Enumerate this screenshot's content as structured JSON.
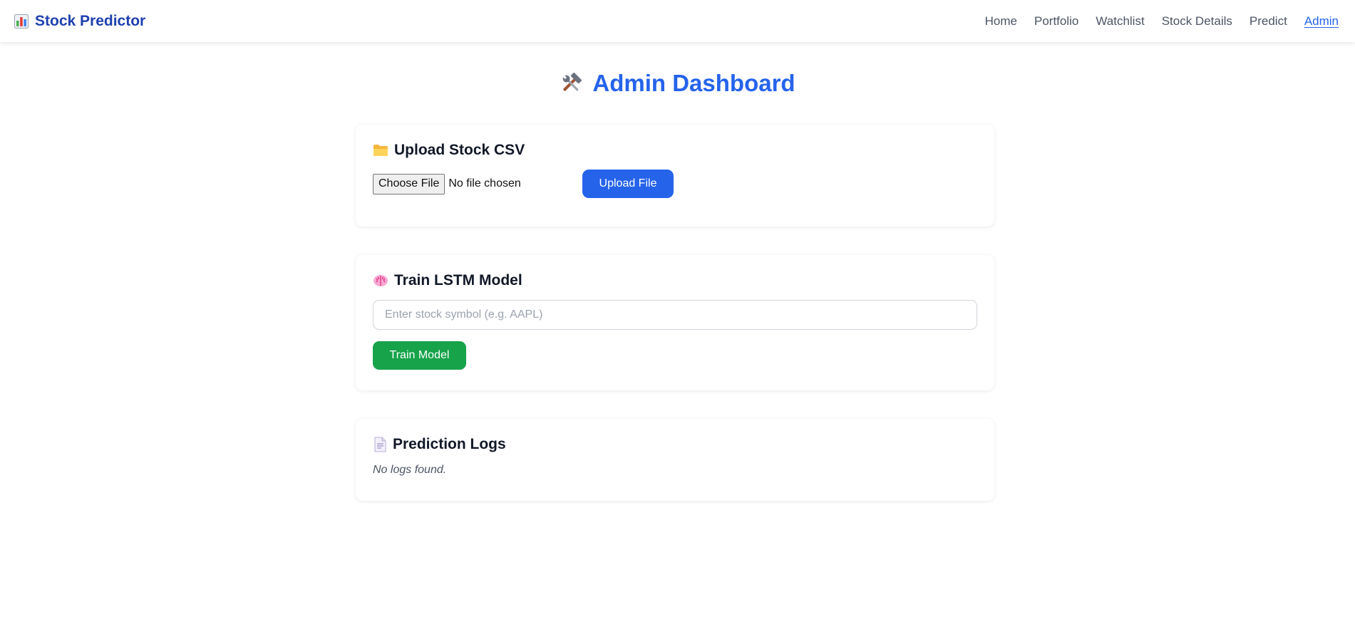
{
  "nav": {
    "brand": "Stock Predictor",
    "brand_icon": "bar-chart-icon",
    "links": [
      {
        "label": "Home"
      },
      {
        "label": "Portfolio"
      },
      {
        "label": "Watchlist"
      },
      {
        "label": "Stock Details"
      },
      {
        "label": "Predict"
      },
      {
        "label": "Admin",
        "active": true
      }
    ]
  },
  "page": {
    "title": "Admin Dashboard",
    "title_icon": "tools-icon"
  },
  "upload": {
    "title": "Upload Stock CSV",
    "icon": "folder-icon",
    "choose_label": "Choose File",
    "file_status": "No file chosen",
    "button_label": "Upload File"
  },
  "train": {
    "title": "Train LSTM Model",
    "icon": "brain-icon",
    "placeholder": "Enter stock symbol (e.g. AAPL)",
    "value": "",
    "button_label": "Train Model"
  },
  "logs": {
    "title": "Prediction Logs",
    "icon": "document-icon",
    "empty_message": "No logs found."
  },
  "colors": {
    "brand": "#1e40af",
    "accent": "#2563eb",
    "success": "#16a34a"
  }
}
